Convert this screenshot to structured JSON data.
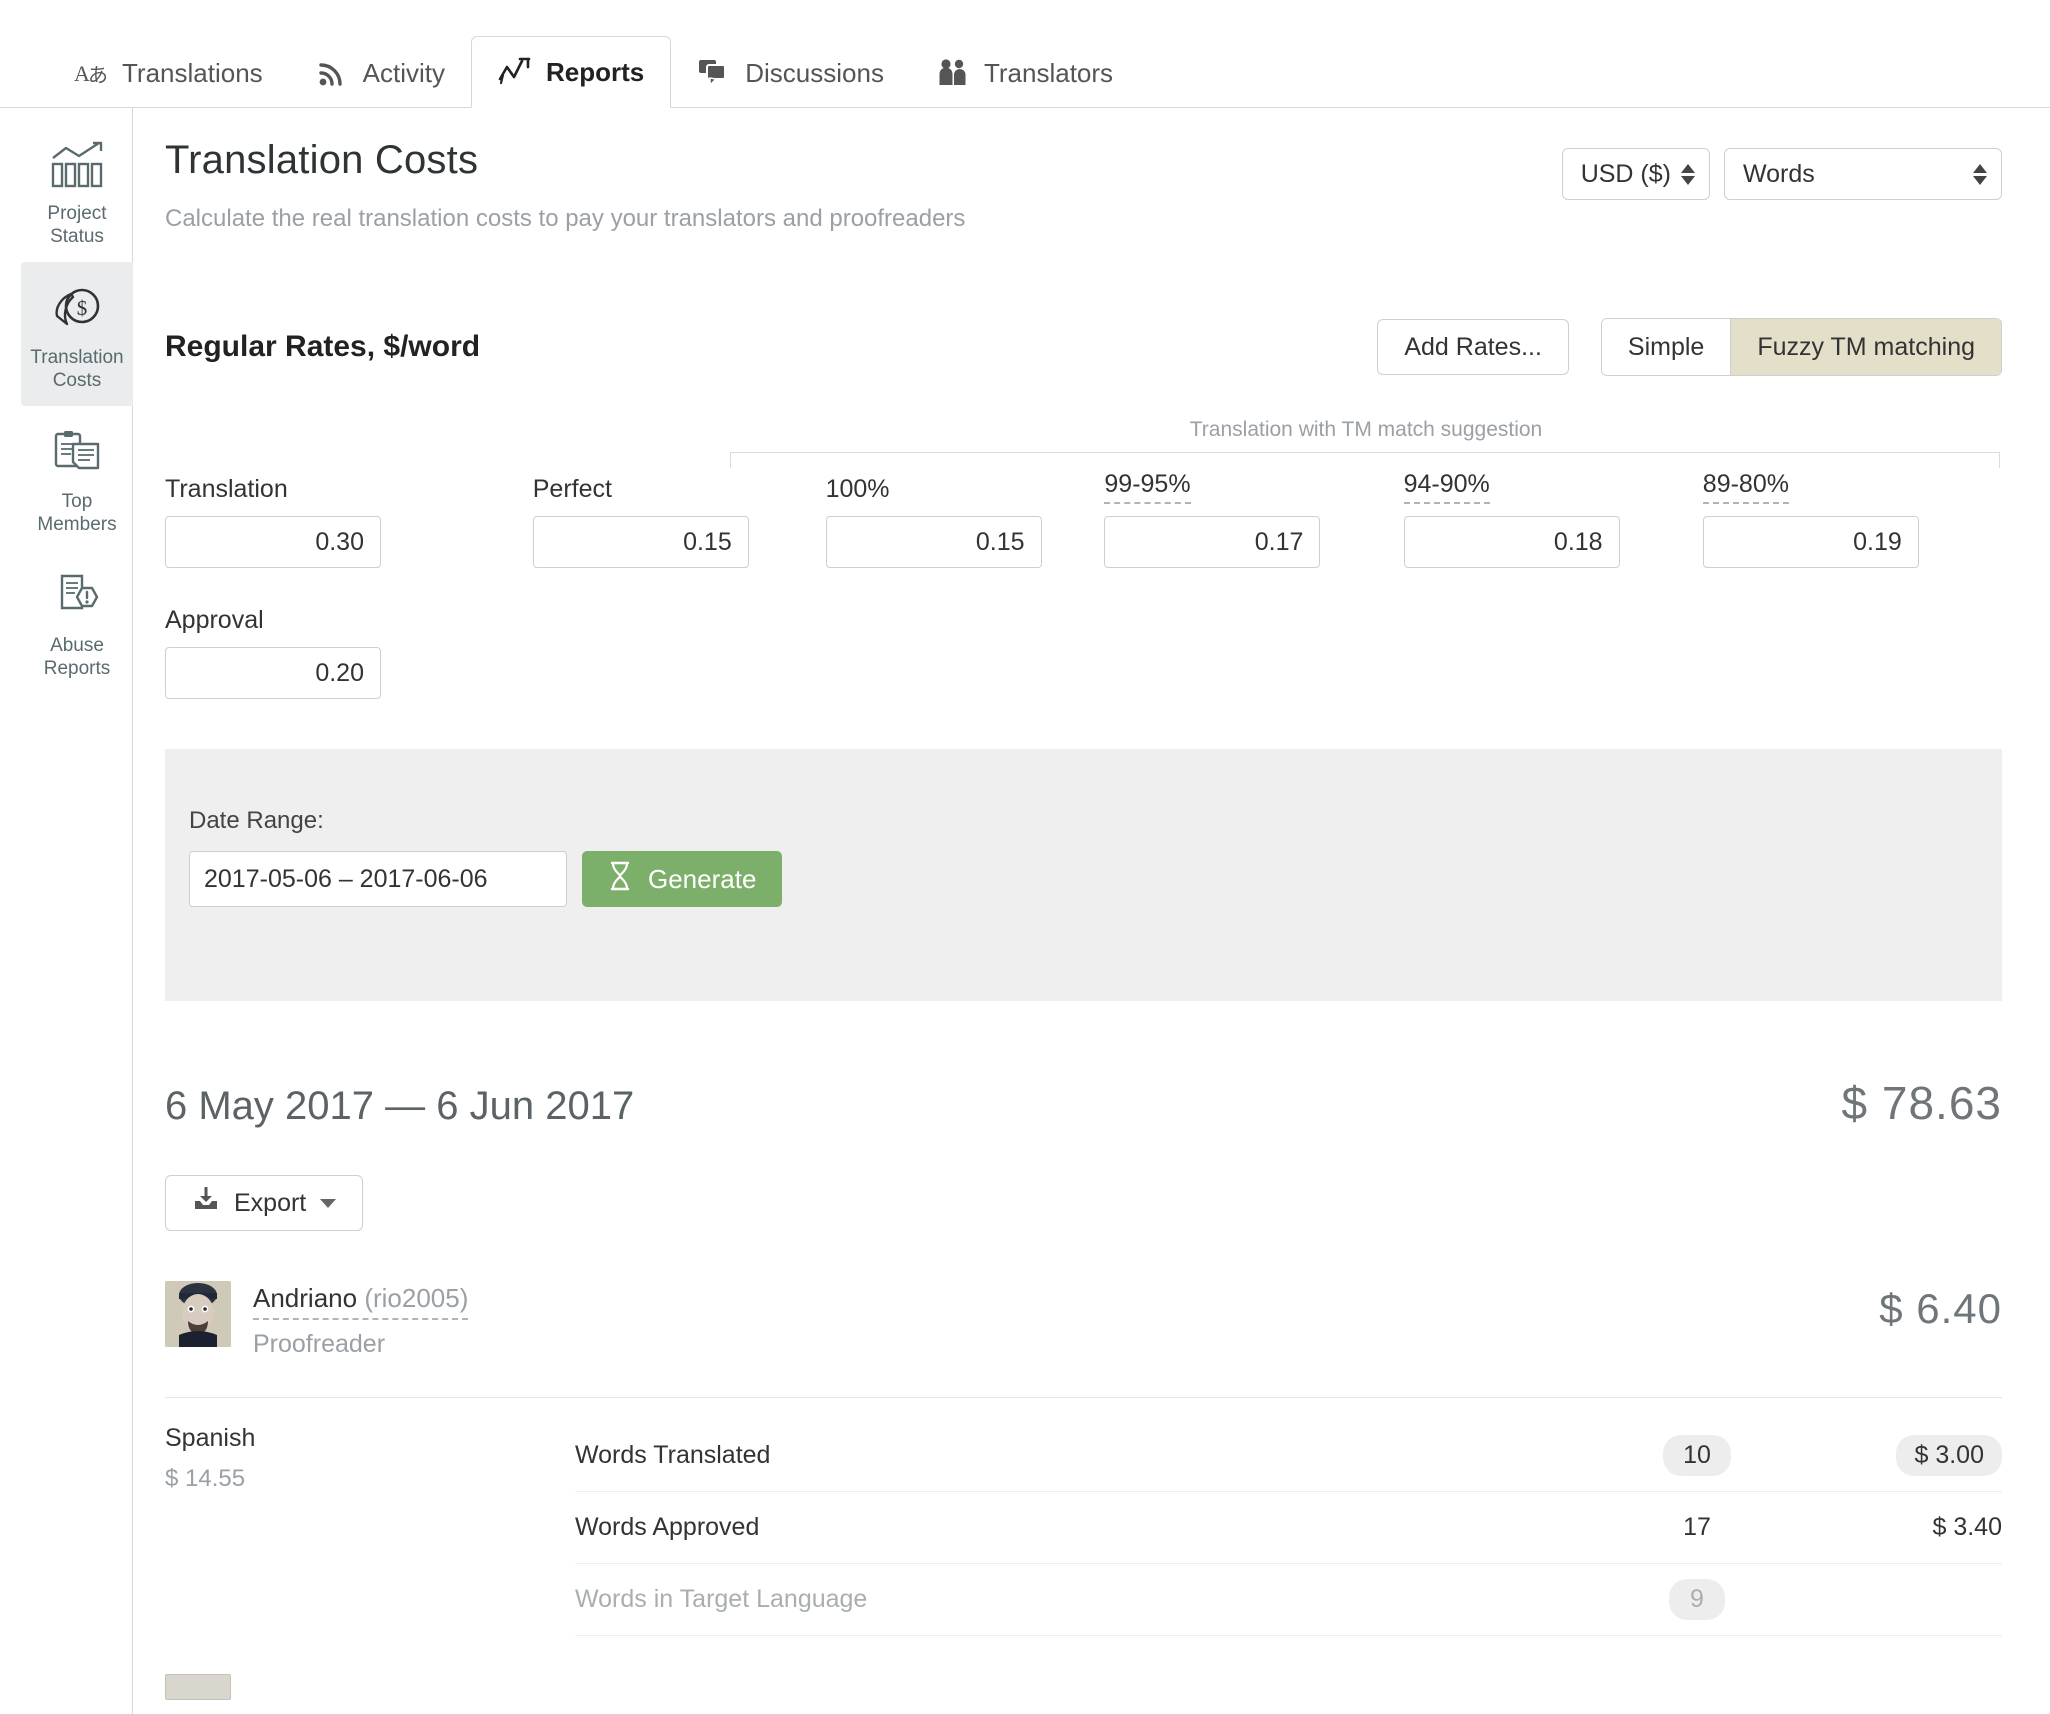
{
  "nav": {
    "tabs": [
      {
        "label": "Translations",
        "icon": "translations-icon",
        "active": false
      },
      {
        "label": "Activity",
        "icon": "activity-rss-icon",
        "active": false
      },
      {
        "label": "Reports",
        "icon": "reports-chart-icon",
        "active": true
      },
      {
        "label": "Discussions",
        "icon": "discussions-chat-icon",
        "active": false
      },
      {
        "label": "Translators",
        "icon": "translators-people-icon",
        "active": false
      }
    ]
  },
  "sidebar": {
    "items": [
      {
        "label_line1": "Project",
        "label_line2": "Status",
        "icon": "bar-chart-icon",
        "active": false
      },
      {
        "label_line1": "Translation",
        "label_line2": "Costs",
        "icon": "coin-dollar-icon",
        "active": true
      },
      {
        "label_line1": "Top",
        "label_line2": "Members",
        "icon": "clipboard-list-icon",
        "active": false
      },
      {
        "label_line1": "Abuse",
        "label_line2": "Reports",
        "icon": "document-warning-icon",
        "active": false
      }
    ]
  },
  "page": {
    "title": "Translation Costs",
    "subtitle": "Calculate the real translation costs to pay your translators and proofreaders",
    "currency_select": "USD ($)",
    "unit_select": "Words"
  },
  "rates": {
    "title": "Regular Rates, $/word",
    "add_rates_label": "Add Rates...",
    "mode_simple": "Simple",
    "mode_fuzzy": "Fuzzy TM matching",
    "active_mode": "Fuzzy TM matching",
    "tm_group_caption": "Translation with TM match suggestion",
    "translation_label": "Translation",
    "translation_value": "0.30",
    "approval_label": "Approval",
    "approval_value": "0.20",
    "tm_columns": [
      {
        "label": "Perfect",
        "value": "0.15",
        "dotted": false
      },
      {
        "label": "100%",
        "value": "0.15",
        "dotted": false
      },
      {
        "label": "99-95%",
        "value": "0.17",
        "dotted": true
      },
      {
        "label": "94-90%",
        "value": "0.18",
        "dotted": true
      },
      {
        "label": "89-80%",
        "value": "0.19",
        "dotted": true
      }
    ]
  },
  "date_range": {
    "label": "Date Range:",
    "value": "2017-05-06 – 2017-06-06",
    "generate_label": "Generate"
  },
  "report": {
    "range_title": "6 May 2017 — 6 Jun 2017",
    "total": "$ 78.63",
    "export_label": "Export",
    "user": {
      "name": "Andriano",
      "username": "(rio2005)",
      "role": "Proofreader",
      "amount": "$ 6.40"
    },
    "language": {
      "name": "Spanish",
      "amount": "$ 14.55"
    },
    "stats": [
      {
        "name": "Words Translated",
        "count": "10",
        "count_style": "pill",
        "money": "$ 3.00",
        "money_style": "pill",
        "muted": false
      },
      {
        "name": "Words Approved",
        "count": "17",
        "count_style": "plain",
        "money": "$ 3.40",
        "money_style": "plain",
        "muted": false
      },
      {
        "name": "Words in Target Language",
        "count": "9",
        "count_style": "pill",
        "money": "",
        "money_style": "plain",
        "muted": true
      }
    ]
  },
  "colors": {
    "accent_green": "#7cb06a",
    "active_tan": "#e3dfc9",
    "sidebar_active": "#eaeced",
    "panel_gray": "#efefef"
  }
}
